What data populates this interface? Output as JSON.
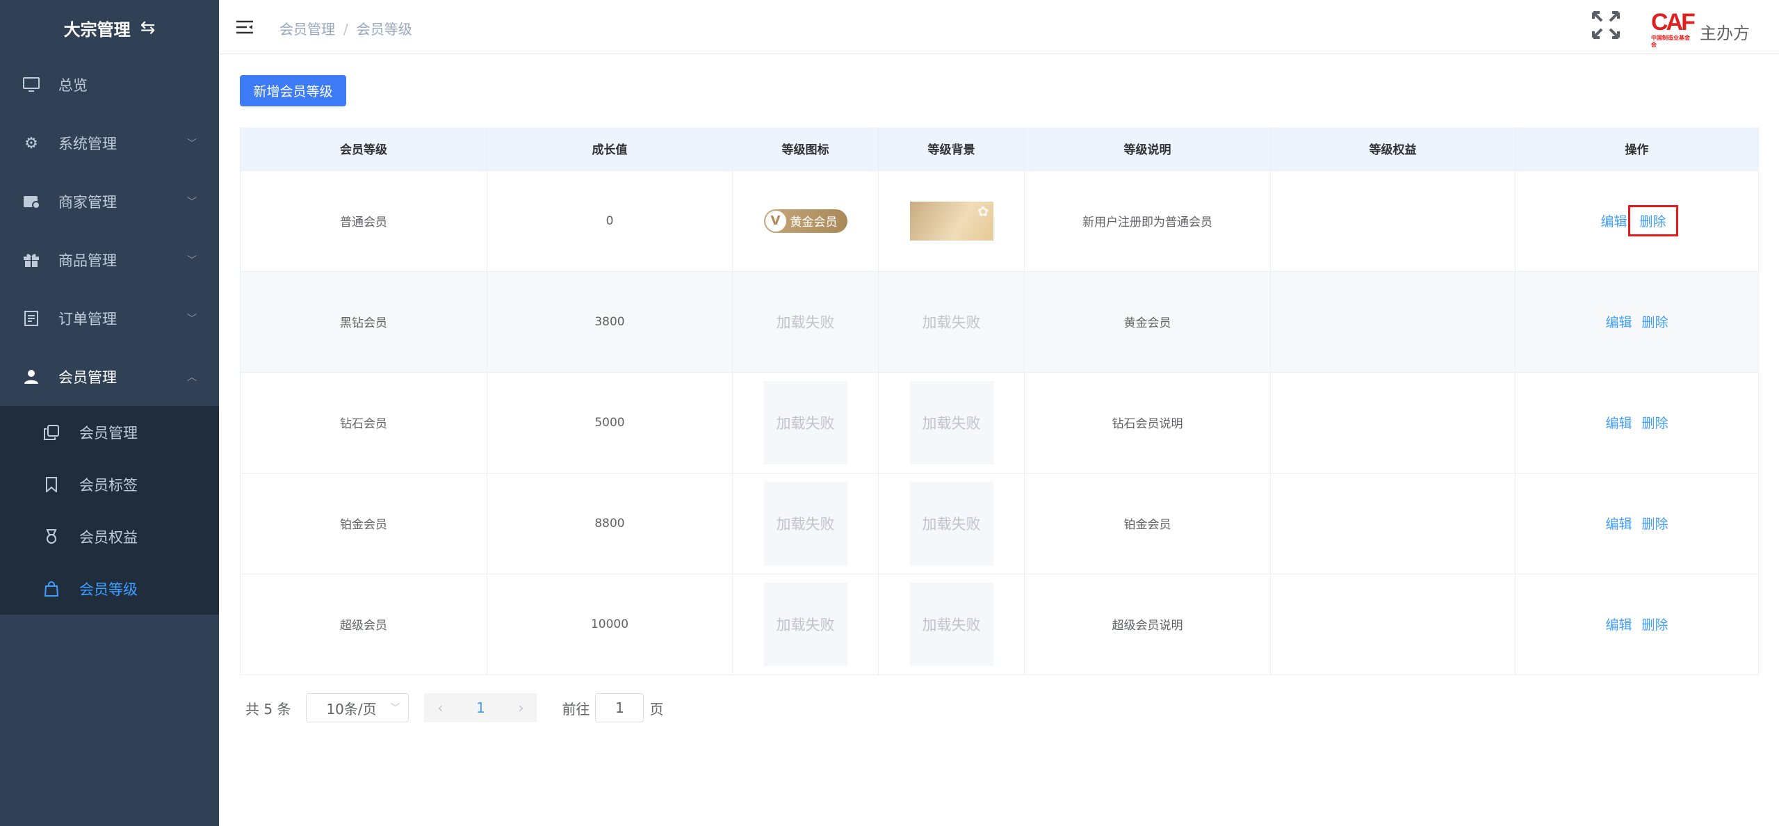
{
  "sidebar": {
    "title": "大宗管理",
    "swap_icon": "⇆",
    "items": [
      {
        "label": "总览",
        "icon": "monitor-icon"
      },
      {
        "label": "系统管理",
        "icon": "gear-icon"
      },
      {
        "label": "商家管理",
        "icon": "store-icon"
      },
      {
        "label": "商品管理",
        "icon": "gift-icon"
      },
      {
        "label": "订单管理",
        "icon": "document-icon"
      },
      {
        "label": "会员管理",
        "icon": "user-icon"
      }
    ],
    "sub_items": [
      {
        "label": "会员管理",
        "icon": "copy-icon"
      },
      {
        "label": "会员标签",
        "icon": "bookmark-icon"
      },
      {
        "label": "会员权益",
        "icon": "medal-icon"
      },
      {
        "label": "会员等级",
        "icon": "bag-icon"
      }
    ]
  },
  "header": {
    "breadcrumb": [
      "会员管理",
      "会员等级"
    ],
    "logo_text": "CAF",
    "logo_sub": "中国制造业基金会",
    "org_label": "主办方"
  },
  "main": {
    "add_button": "新增会员等级",
    "columns": [
      "会员等级",
      "成长值",
      "等级图标",
      "等级背景",
      "等级说明",
      "等级权益",
      "操作"
    ],
    "rows": [
      {
        "level": "普通会员",
        "growth": "0",
        "description": "新用户注册即为普通会员",
        "rights": ""
      },
      {
        "level": "黑钻会员",
        "growth": "3800",
        "description": "黄金会员",
        "rights": ""
      },
      {
        "level": "钻石会员",
        "growth": "5000",
        "description": "钻石会员说明",
        "rights": ""
      },
      {
        "level": "铂金会员",
        "growth": "8800",
        "description": "铂金会员",
        "rights": ""
      },
      {
        "level": "超级会员",
        "growth": "10000",
        "description": "超级会员说明",
        "rights": ""
      }
    ],
    "badge_text": "黄金会员",
    "badge_letter": "V",
    "load_failed": "加载失败",
    "edit_label": "编辑",
    "delete_label": "删除"
  },
  "pagination": {
    "total": "共 5 条",
    "page_size": "10条/页",
    "current_page": "1",
    "goto_label": "前往",
    "goto_value": "1",
    "page_suffix": "页"
  },
  "colors": {
    "sidebar_bg": "#304156",
    "accent": "#409eff",
    "primary_button": "#3d7bf7",
    "highlight_box": "#e6191b"
  }
}
